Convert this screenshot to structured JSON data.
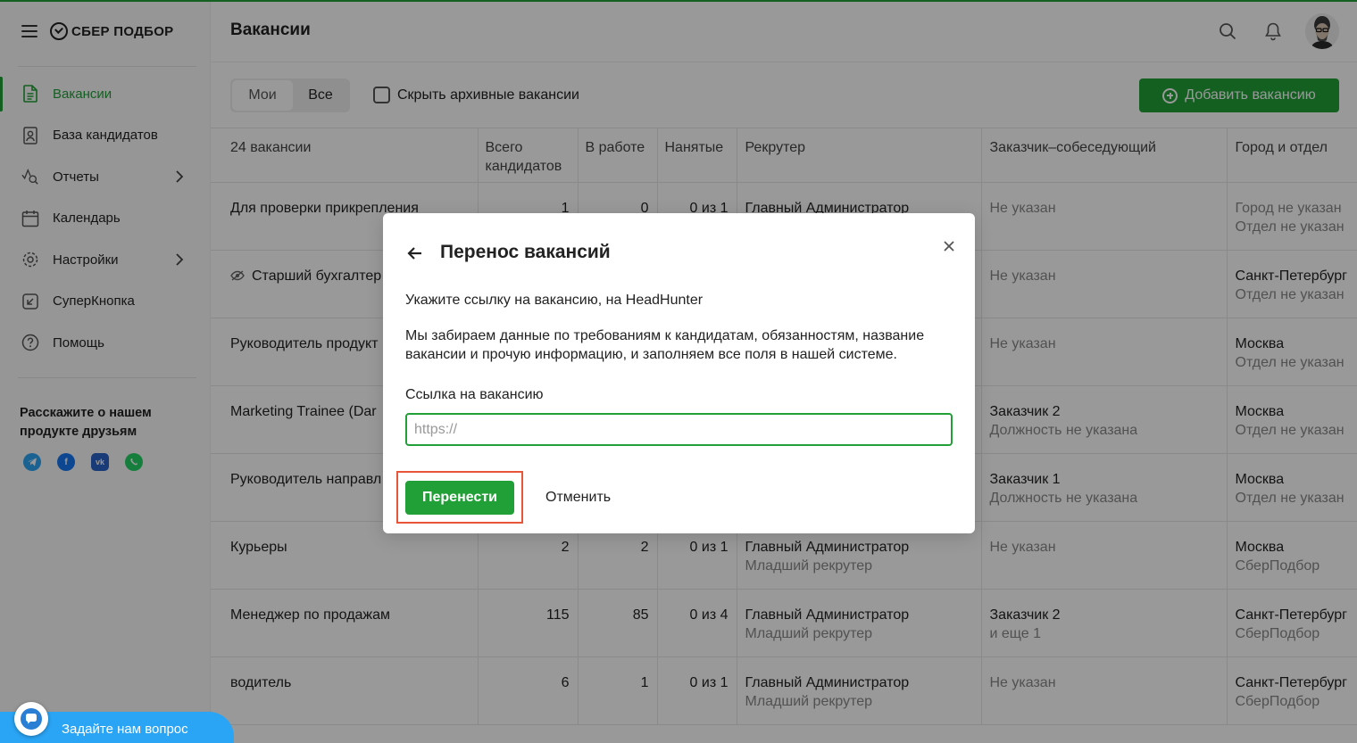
{
  "app": {
    "logo_text": "СБЕР ПОДБОР",
    "accent_color": "#21a038"
  },
  "sidebar": {
    "items": [
      {
        "label": "Вакансии",
        "icon": "document-icon",
        "active": true
      },
      {
        "label": "База кандидатов",
        "icon": "person-card-icon"
      },
      {
        "label": "Отчеты",
        "icon": "chart-search-icon",
        "has_submenu": true
      },
      {
        "label": "Календарь",
        "icon": "calendar-icon"
      },
      {
        "label": "Настройки",
        "icon": "gear-icon",
        "has_submenu": true
      },
      {
        "label": "СуперКнопка",
        "icon": "super-button-icon"
      },
      {
        "label": "Помощь",
        "icon": "help-icon"
      }
    ],
    "share_title": "Расскажите о нашем продукте друзьям",
    "socials": [
      "telegram-icon",
      "facebook-icon",
      "vk-icon",
      "whatsapp-icon"
    ],
    "ask_label": "Задайте нам вопрос"
  },
  "header": {
    "title": "Вакансии"
  },
  "toolbar": {
    "seg_mine": "Мои",
    "seg_all": "Все",
    "hide_archive_label": "Скрыть архивные вакансии",
    "add_label": "Добавить вакансию"
  },
  "table": {
    "headers": [
      "24 вакансии",
      "Всего кандидатов",
      "В работе",
      "Нанятые",
      "Рекрутер",
      "Заказчик–собеседующий",
      "Город и отдел"
    ],
    "rows": [
      {
        "title": "Для проверки прикрепления",
        "total": "1",
        "in_work": "0",
        "hired": "0 из 1",
        "recruiter": "Главный Администратор",
        "recruiter_sub": "",
        "customer": "Не указан",
        "customer_sub": "",
        "city": "Город не указан",
        "dept": "Отдел не указан",
        "city_muted": true
      },
      {
        "title": "Старший бухгалтер",
        "total": "",
        "in_work": "",
        "hired": "",
        "recruiter": "",
        "recruiter_sub": "",
        "customer": "Не указан",
        "customer_sub": "",
        "city": "Санкт-Петербург",
        "dept": "Отдел не указан",
        "hidden_icon": true
      },
      {
        "title": "Руководитель продукт",
        "total": "",
        "in_work": "",
        "hired": "",
        "recruiter": "",
        "recruiter_sub": "",
        "customer": "Не указан",
        "customer_sub": "",
        "city": "Москва",
        "dept": "Отдел не указан"
      },
      {
        "title": "Marketing Trainee (Dar",
        "total": "",
        "in_work": "",
        "hired": "",
        "recruiter": "",
        "recruiter_sub": "",
        "customer": "Заказчик 2",
        "customer_sub": "Должность не указана",
        "city": "Москва",
        "dept": "Отдел не указан"
      },
      {
        "title": "Руководитель направл",
        "total": "",
        "in_work": "",
        "hired": "",
        "recruiter": "",
        "recruiter_sub": "",
        "customer": "Заказчик 1",
        "customer_sub": "Должность не указана",
        "city": "Москва",
        "dept": "Отдел не указан"
      },
      {
        "title": "Курьеры",
        "total": "2",
        "in_work": "2",
        "hired": "0 из 1",
        "recruiter": "Главный Администратор",
        "recruiter_sub": "Младший рекрутер",
        "customer": "Не указан",
        "customer_sub": "",
        "city": "Москва",
        "dept": "СберПодбор"
      },
      {
        "title": "Менеджер по продажам",
        "total": "115",
        "in_work": "85",
        "hired": "0 из 4",
        "recruiter": "Главный Администратор",
        "recruiter_sub": "Младший рекрутер",
        "customer": "Заказчик 2",
        "customer_sub": "и еще 1",
        "city": "Санкт-Петербург",
        "dept": "СберПодбор"
      },
      {
        "title": "водитель",
        "total": "6",
        "in_work": "1",
        "hired": "0 из 1",
        "recruiter": "Главный Администратор",
        "recruiter_sub": "Младший рекрутер",
        "customer": "Не указан",
        "customer_sub": "",
        "city": "Санкт-Петербург",
        "dept": "СберПодбор"
      }
    ]
  },
  "modal": {
    "title": "Перенос вакансий",
    "subtitle": "Укажите ссылку на вакансию, на HeadHunter",
    "description": "Мы забираем данные по требованиям к кандидатам, обязанностям, название вакансии и прочую информацию, и заполняем все поля в нашей системе.",
    "field_label": "Ссылка на вакансию",
    "field_placeholder": "https://",
    "field_value": "",
    "submit_label": "Перенести",
    "cancel_label": "Отменить"
  }
}
